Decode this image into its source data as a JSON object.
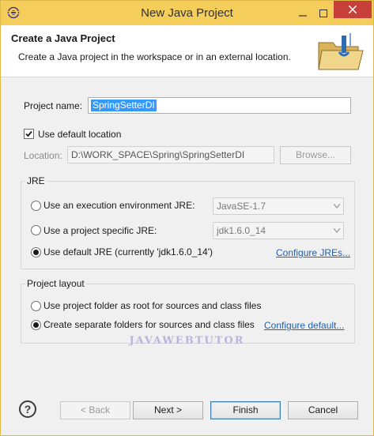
{
  "window": {
    "title": "New Java Project"
  },
  "header": {
    "title": "Create a Java Project",
    "description": "Create a Java project in the workspace or in an external location."
  },
  "project_name": {
    "label": "Project name:",
    "value": "SpringSetterDI"
  },
  "use_default_location": {
    "label": "Use default location",
    "checked": true
  },
  "location": {
    "label": "Location:",
    "value": "D:\\WORK_SPACE\\Spring\\SpringSetterDI",
    "browse_label": "Browse..."
  },
  "jre": {
    "title": "JRE",
    "options": [
      {
        "label": "Use an execution environment JRE:",
        "selected": false,
        "combo_value": "JavaSE-1.7"
      },
      {
        "label": "Use a project specific JRE:",
        "selected": false,
        "combo_value": "jdk1.6.0_14"
      },
      {
        "label": "Use default JRE (currently 'jdk1.6.0_14')",
        "selected": true
      }
    ],
    "configure_link": "Configure JREs..."
  },
  "project_layout": {
    "title": "Project layout",
    "options": [
      {
        "label": "Use project folder as root for sources and class files",
        "selected": false
      },
      {
        "label": "Create separate folders for sources and class files",
        "selected": true
      }
    ],
    "configure_link": "Configure default..."
  },
  "watermark": "JAVAWEBTUTOR",
  "buttons": {
    "back": "< Back",
    "next": "Next >",
    "finish": "Finish",
    "cancel": "Cancel"
  },
  "colors": {
    "titlebar": "#f5cd5a",
    "selection": "#3399ff",
    "link": "#1f5fb0",
    "close": "#c7413a"
  }
}
